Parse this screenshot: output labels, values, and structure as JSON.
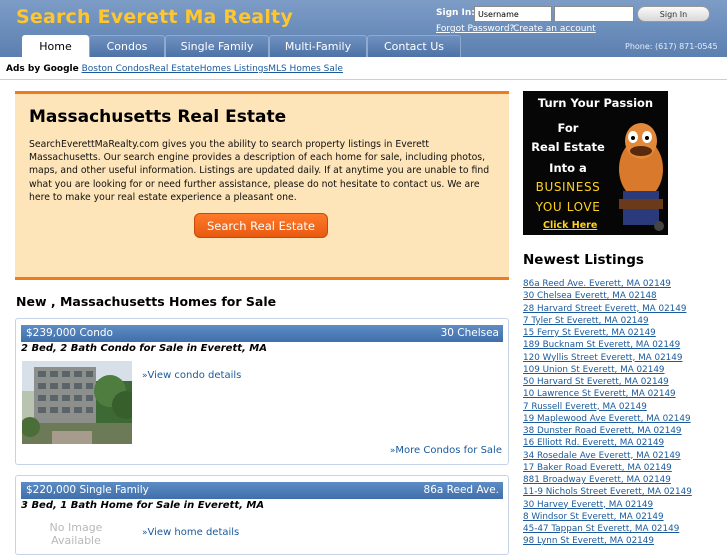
{
  "header": {
    "site_title": "Search Everett Ma Realty",
    "signin_label": "Sign In:",
    "username_value": "Username",
    "password_value": "",
    "signin_button": "Sign In",
    "forgot_password": "Forgot Password?",
    "create_account": "Create an account",
    "phone": "Phone: (617) 871-0545",
    "colors": {
      "bar": "#5b7fb0",
      "title": "#ffc62e"
    }
  },
  "nav": {
    "tabs": [
      {
        "label": "Home",
        "active": true
      },
      {
        "label": "Condos",
        "active": false
      },
      {
        "label": "Single Family",
        "active": false
      },
      {
        "label": "Multi-Family",
        "active": false
      },
      {
        "label": "Contact Us",
        "active": false
      }
    ]
  },
  "ads": {
    "label": "Ads by Google",
    "links": [
      "Boston Condos",
      "Real Estate",
      "Homes Listings",
      "MLS Homes Sale"
    ]
  },
  "intro": {
    "title": "Massachusetts Real Estate",
    "text": "SearchEverettMaRealty.com gives you the ability to search property listings in Everett Massachusetts. Our search engine provides a description of each home for sale, including photos, maps, and other useful information. Listings are updated daily. If at anytime you are unable to find what you are looking for or need further assistance, please do not hesitate to contact us. We are here to make your real estate experience a pleasant one.",
    "button": "Search  Real Estate",
    "colors": {
      "background": "#fde4b9",
      "accent": "#f07b1f"
    }
  },
  "section_heading": "New , Massachusetts Homes for Sale",
  "listings": [
    {
      "price_type": "$239,000 Condo",
      "address": "30 Chelsea",
      "subtitle": "2 Bed, 2 Bath Condo for Sale in Everett, MA",
      "details_link": "View condo details",
      "more_link": "More Condos for Sale",
      "has_photo": true
    },
    {
      "price_type": "$220,000 Single Family",
      "address": "86a Reed Ave.",
      "subtitle": "3 Bed, 1 Bath Home for Sale in Everett, MA",
      "details_link": "View home details",
      "no_image_text": "No Image Available",
      "has_photo": false
    }
  ],
  "ad_banner": {
    "line1": "Turn Your Passion",
    "line2": "For",
    "line3": "Real Estate",
    "line4": "Into a",
    "line5": "BUSINESS",
    "line6": "YOU LOVE",
    "cta": "Click Here"
  },
  "newest": {
    "title": "Newest Listings",
    "items": [
      "86a Reed Ave. Everett, MA 02149",
      "30 Chelsea Everett, MA 02148",
      "28 Harvard Street Everett, MA 02149",
      "7 Tyler St Everett, MA 02149",
      "15 Ferry St Everett, MA 02149",
      "189 Bucknam St Everett, MA 02149",
      "120 Wyllis Street Everett, MA 02149",
      "109 Union St Everett, MA 02149",
      "50 Harvard St Everett, MA 02149",
      "10 Lawrence St Everett, MA 02149",
      "7 Russell Everett, MA 02149",
      "19 Maplewood Ave Everett, MA 02149",
      "38 Dunster Road Everett, MA 02149",
      "16 Elliott Rd. Everett, MA 02149",
      "34 Rosedale Ave Everett, MA 02149",
      "17 Baker Road Everett, MA 02149",
      "881 Broadway Everett, MA 02149",
      "11-9 Nichols Street Everett, MA 02149",
      "30 Harvey Everett, MA 02149",
      "8 Windsor St Everett, MA 02149",
      "45-47 Tappan St Everett, MA 02149",
      "98 Lynn St Everett, MA 02149"
    ]
  }
}
